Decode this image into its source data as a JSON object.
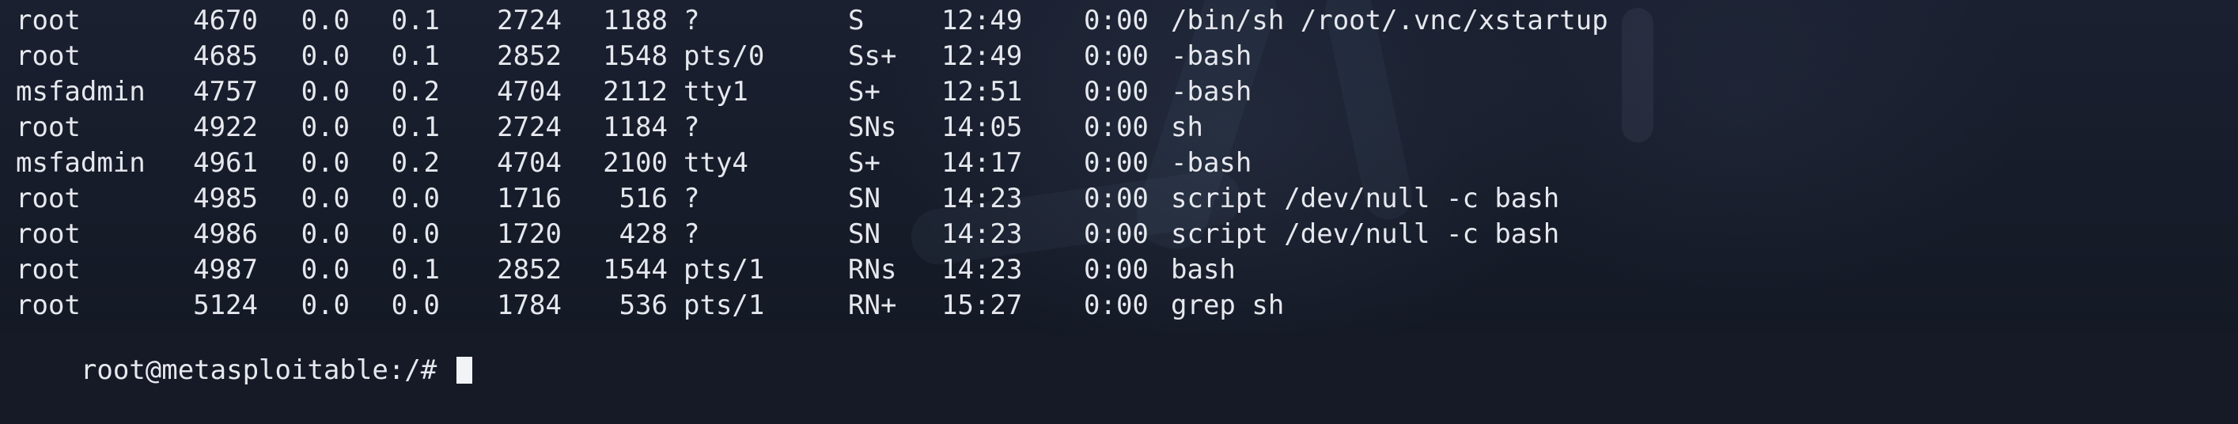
{
  "terminal": {
    "rows": [
      {
        "user": "root",
        "pid": "4670",
        "cpu": "0.0",
        "mem": "0.1",
        "vsz": "2724",
        "rss": "1188",
        "tty": "?",
        "stat": "S",
        "start": "12:49",
        "time": "0:00",
        "command": "/bin/sh /root/.vnc/xstartup"
      },
      {
        "user": "root",
        "pid": "4685",
        "cpu": "0.0",
        "mem": "0.1",
        "vsz": "2852",
        "rss": "1548",
        "tty": "pts/0",
        "stat": "Ss+",
        "start": "12:49",
        "time": "0:00",
        "command": "-bash"
      },
      {
        "user": "msfadmin",
        "pid": "4757",
        "cpu": "0.0",
        "mem": "0.2",
        "vsz": "4704",
        "rss": "2112",
        "tty": "tty1",
        "stat": "S+",
        "start": "12:51",
        "time": "0:00",
        "command": "-bash"
      },
      {
        "user": "root",
        "pid": "4922",
        "cpu": "0.0",
        "mem": "0.1",
        "vsz": "2724",
        "rss": "1184",
        "tty": "?",
        "stat": "SNs",
        "start": "14:05",
        "time": "0:00",
        "command": "sh"
      },
      {
        "user": "msfadmin",
        "pid": "4961",
        "cpu": "0.0",
        "mem": "0.2",
        "vsz": "4704",
        "rss": "2100",
        "tty": "tty4",
        "stat": "S+",
        "start": "14:17",
        "time": "0:00",
        "command": "-bash"
      },
      {
        "user": "root",
        "pid": "4985",
        "cpu": "0.0",
        "mem": "0.0",
        "vsz": "1716",
        "rss": "516",
        "tty": "?",
        "stat": "SN",
        "start": "14:23",
        "time": "0:00",
        "command": "script /dev/null -c bash"
      },
      {
        "user": "root",
        "pid": "4986",
        "cpu": "0.0",
        "mem": "0.0",
        "vsz": "1720",
        "rss": "428",
        "tty": "?",
        "stat": "SN",
        "start": "14:23",
        "time": "0:00",
        "command": "script /dev/null -c bash"
      },
      {
        "user": "root",
        "pid": "4987",
        "cpu": "0.0",
        "mem": "0.1",
        "vsz": "2852",
        "rss": "1544",
        "tty": "pts/1",
        "stat": "RNs",
        "start": "14:23",
        "time": "0:00",
        "command": "bash"
      },
      {
        "user": "root",
        "pid": "5124",
        "cpu": "0.0",
        "mem": "0.0",
        "vsz": "1784",
        "rss": "536",
        "tty": "pts/1",
        "stat": "RN+",
        "start": "15:27",
        "time": "0:00",
        "command": "grep sh"
      }
    ],
    "prompt": "root@metasploitable:/# "
  },
  "theme": {
    "text_color": "#e6e8ee",
    "background_color": "#151a26",
    "cursor_color": "#f2f3f6"
  }
}
